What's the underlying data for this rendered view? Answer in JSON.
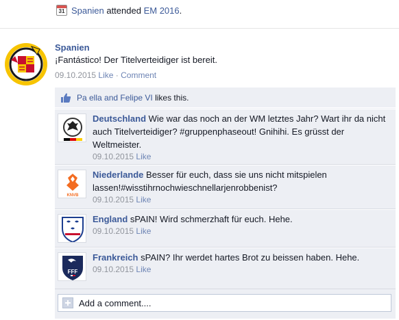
{
  "activity": {
    "calendar_day": "31",
    "subject": "Spanien",
    "verb": "attended",
    "event": "EM 2016",
    "period": "."
  },
  "post": {
    "author": "Spanien",
    "text": "¡Fantástico! Der Titelverteidiger ist bereit.",
    "date": "09.10.2015",
    "like_label": "Like",
    "separator": "·",
    "comment_label": "Comment"
  },
  "likes": {
    "names": "Pa ella and Felipe VI",
    "suffix": "likes this."
  },
  "comments": [
    {
      "author": "Deutschland",
      "text": "Wie war das noch an der WM letztes Jahr? Wart ihr da nicht auch Titelverteidiger? #gruppenphaseout! Gnihihi. Es grüsst der Weltmeister.",
      "date": "09.10.2015",
      "like_label": "Like"
    },
    {
      "author": "Niederlande",
      "text": "Besser für euch, dass sie uns nicht mitspielen lassen!#wisstihrnochwieschnellarjenrobbenist?",
      "date": "09.10.2015",
      "like_label": "Like"
    },
    {
      "author": "England",
      "text": "sPAIN! Wird schmerzhaft für euch. Hehe.",
      "date": "09.10.2015",
      "like_label": "Like"
    },
    {
      "author": "Frankreich",
      "text": "sPAIN? Ihr werdet hartes Brot zu beissen haben. Hehe.",
      "date": "09.10.2015",
      "like_label": "Like"
    }
  ],
  "add_comment": {
    "placeholder": "Add a comment...."
  },
  "logos": {
    "knvb": "KNVB",
    "fff": "FFF"
  },
  "colors": {
    "link": "#3b5998",
    "meta": "#90949c",
    "ufi_bg": "#edeff4"
  }
}
